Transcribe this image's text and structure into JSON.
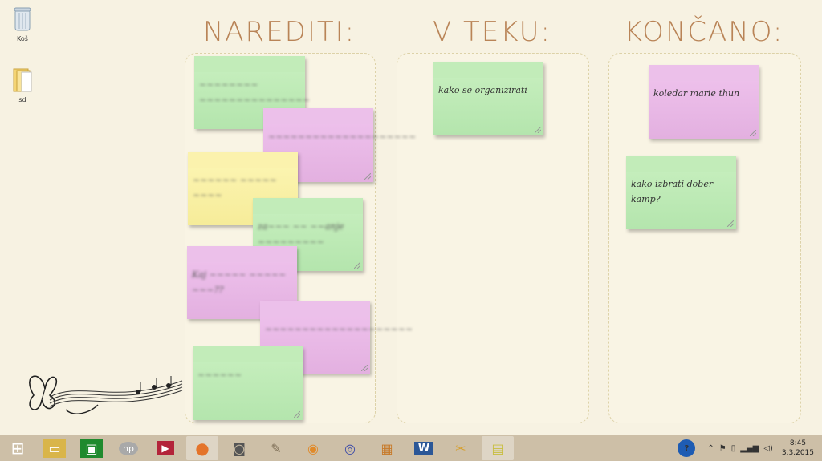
{
  "desktop": {
    "icons": [
      {
        "label": "Koš"
      },
      {
        "label": "sd"
      }
    ]
  },
  "columns": [
    {
      "title": "NAREDITI:"
    },
    {
      "title": "V TEKU:"
    },
    {
      "title": "KONČANO:"
    }
  ],
  "notes": {
    "todo": [
      {
        "text": "~~~~~~~~ ~~~~~~~~~~~~~~~",
        "color": "#c9f0c0"
      },
      {
        "text": "~~~~~~~~~~~~~~~~~~~~",
        "color": "#f0c4ee"
      },
      {
        "text": "~~~~~~ ~~~~~ ~~~~",
        "color": "#fdf6b6"
      },
      {
        "text": "za~~~ ~~ ~~anje ~~~~~~~~~",
        "color": "#c9f0c0"
      },
      {
        "text": "Kaj ~~~~~ ~~~~~ ~~~??",
        "color": "#f0c4ee"
      },
      {
        "text": "~~~~~~~~~~~~~~~~~~~~",
        "color": "#f0c4ee"
      },
      {
        "text": "~~~~~~",
        "color": "#c9f0c0"
      }
    ],
    "inprogress": [
      {
        "text": "kako se organizirati",
        "color": "#c9f0c0"
      }
    ],
    "done": [
      {
        "text": "koledar marie thun",
        "color": "#f0c4ee"
      },
      {
        "text": "kako izbrati dober kamp?",
        "color": "#c9f0c0"
      }
    ]
  },
  "taskbar": {
    "apps": [
      {
        "icon": "windows-start-icon",
        "glyph": "⊞",
        "bg": "#cdbfa7"
      },
      {
        "icon": "file-explorer-icon",
        "glyph": "▭",
        "bg": "#d9b54a"
      },
      {
        "icon": "store-icon",
        "glyph": "▣",
        "bg": "#1f8a2e"
      },
      {
        "icon": "hp-icon",
        "glyph": "hp",
        "bg": "#a9a9a9"
      },
      {
        "icon": "media-icon",
        "glyph": "▶",
        "bg": "#b3243a"
      },
      {
        "icon": "firefox-icon",
        "glyph": "●",
        "bg": "#e4742b"
      },
      {
        "icon": "camera-icon",
        "glyph": "◙",
        "bg": "#555555"
      },
      {
        "icon": "gimp-icon",
        "glyph": "✎",
        "bg": "#7a6a52"
      },
      {
        "icon": "blender-icon",
        "glyph": "◉",
        "bg": "#e08a2a"
      },
      {
        "icon": "torrent-icon",
        "glyph": "◎",
        "bg": "#3b4aa8"
      },
      {
        "icon": "video-icon",
        "glyph": "▦",
        "bg": "#c77a2a"
      },
      {
        "icon": "word-icon",
        "glyph": "W",
        "bg": "#2b5797"
      },
      {
        "icon": "tools-icon",
        "glyph": "✂",
        "bg": "#d6a030"
      },
      {
        "icon": "sticky-notes-icon",
        "glyph": "▤",
        "bg": "#e9e07a"
      }
    ],
    "tray": {
      "help": "?",
      "clock_time": "8:45",
      "clock_date": "3.3.2015"
    }
  }
}
